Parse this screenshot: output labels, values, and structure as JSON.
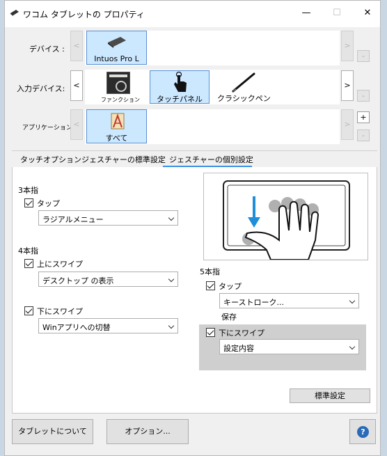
{
  "background": {
    "partial_text": "タッチバネ"
  },
  "window": {
    "title": "ワコム タブレットの プロパティ",
    "controls": {
      "minimize": "—",
      "maximize": "☐",
      "close": "✕"
    }
  },
  "device_row": {
    "label": "デバイス :",
    "nav_left": "<",
    "nav_right": ">",
    "remove": "-",
    "items": [
      {
        "label": "Intuos Pro L"
      }
    ]
  },
  "input_row": {
    "label": "入力デバイス:",
    "nav_left": "<",
    "nav_right": ">",
    "remove": "-",
    "items": [
      {
        "label": "ファンクション"
      },
      {
        "label": "タッチパネル"
      },
      {
        "label": "クラシックペン"
      }
    ]
  },
  "app_row": {
    "label": "アプリケーション:",
    "nav_left": "<",
    "nav_right": ">",
    "add": "+",
    "remove": "-",
    "items": [
      {
        "label": "すべて"
      }
    ]
  },
  "tabs": [
    "タッチオプション",
    "ジェスチャーの標準設定",
    "ジェスチャーの個別設定"
  ],
  "active_tab": 2,
  "three_finger": {
    "title": "3本指",
    "checkbox": "タップ",
    "select": "ラジアルメニュー"
  },
  "four_finger": {
    "title": "4本指",
    "swipe_up": {
      "checkbox": "上にスワイプ",
      "select": "デスクトップ の表示"
    },
    "swipe_down": {
      "checkbox": "下にスワイプ",
      "select": "Winアプリへの切替"
    }
  },
  "five_finger": {
    "title": "5本指",
    "tap": {
      "checkbox": "タップ",
      "select": "キーストローク..."
    },
    "saved": "保存",
    "swipe_down": {
      "checkbox": "下にスワイプ",
      "select": "設定内容"
    }
  },
  "buttons": {
    "default": "標準設定",
    "about": "タブレットについて",
    "options": "オプション...",
    "help": "?"
  },
  "colors": {
    "selected_fill": "#cce8ff",
    "tab_accent": "#3a8ee6",
    "arrow": "#1e8fd8",
    "help": "#2a6ab8"
  }
}
